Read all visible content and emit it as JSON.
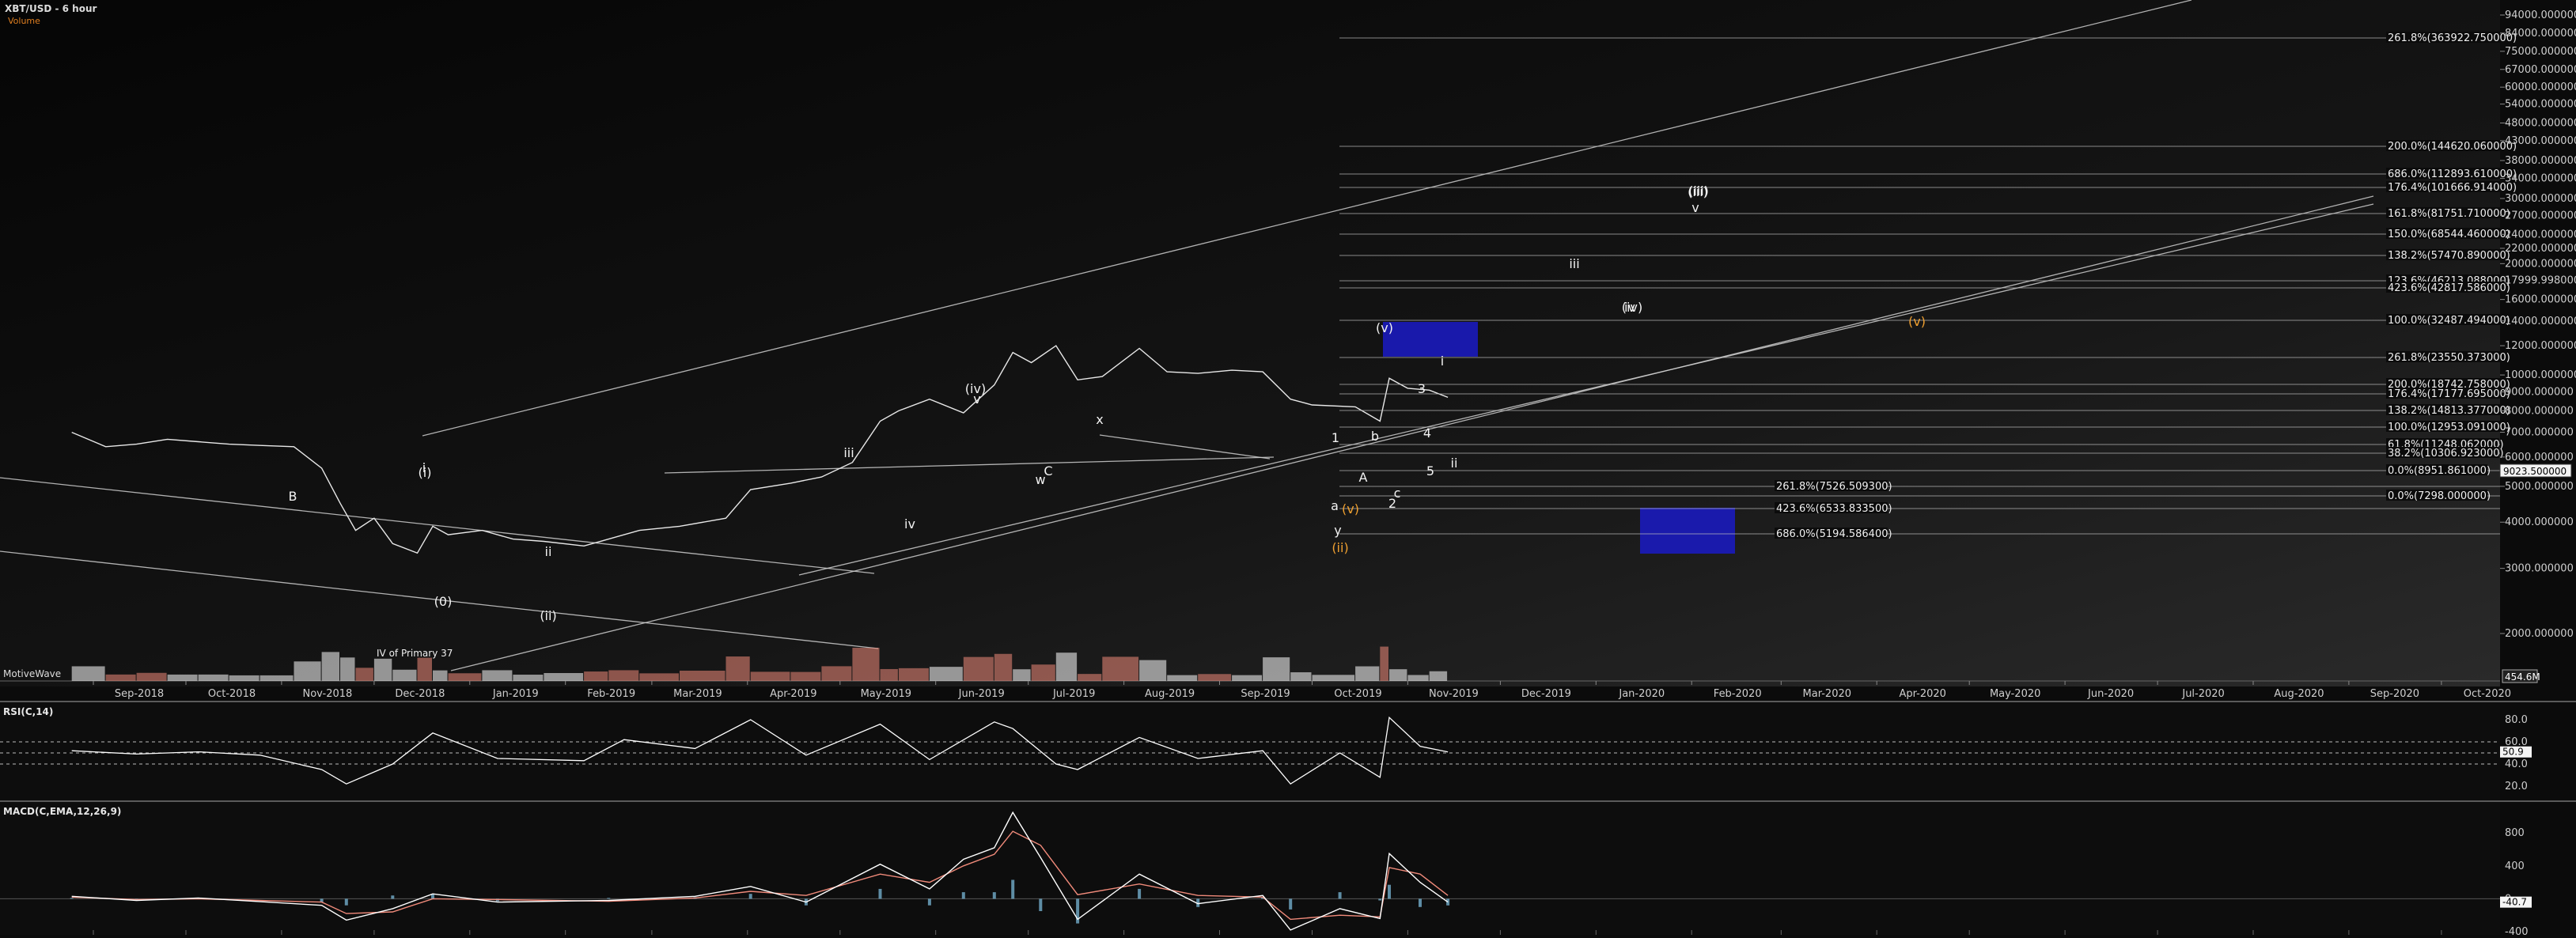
{
  "header": {
    "title": "XBT/USD - 6 hour",
    "subtitle": "Volume",
    "watermark": "MotiveWave",
    "volume_readout": "454.6M",
    "price_readout": "9023.500000",
    "annotation_primary": "IV of Primary 37"
  },
  "colors": {
    "background": "#0b0b0b",
    "price": "#e8e8e8",
    "volume_up": "#f08a7a",
    "volume_down": "#ffffff",
    "rsi": "#ffffff",
    "rsi_fill": "#c8a6b0",
    "macd": "#ffffff",
    "signal": "#f08a7a",
    "histogram": "#7ab8d8",
    "target_box": "#1a1ab8",
    "wave_orange": "#f0a030",
    "wave_red": "#ff3030"
  },
  "chart_data": [
    {
      "type": "line",
      "title": "XBT/USD - 6 hour",
      "y_scale": "log",
      "ylim": [
        1500,
        100000
      ],
      "x_ticks": [
        "Sep-2018",
        "Oct-2018",
        "Nov-2018",
        "Dec-2018",
        "Jan-2019",
        "Feb-2019",
        "Mar-2019",
        "Apr-2019",
        "May-2019",
        "Jun-2019",
        "Jul-2019",
        "Aug-2019",
        "Sep-2019",
        "Oct-2019",
        "Nov-2019",
        "Dec-2019",
        "Jan-2020",
        "Feb-2020",
        "Mar-2020",
        "Apr-2020",
        "May-2020",
        "Jun-2020",
        "Jul-2020",
        "Aug-2020",
        "Sep-2020",
        "Oct-2020"
      ],
      "y_ticks": [
        2000,
        3000,
        4000,
        5000,
        6000,
        7000,
        8000,
        9000,
        10000,
        12000,
        14000,
        16000,
        18000,
        20000,
        22000,
        24000,
        27000,
        30000,
        34000,
        38000,
        43000,
        48000,
        54000,
        60000,
        67000,
        75000,
        84000,
        94000
      ],
      "y_tick_labels": [
        "2000.000000",
        "3000.000000",
        "4000.000000",
        "5000.000000",
        "6000.000000",
        "7000.000000",
        "8000.000000",
        "9000.000000",
        "10000.000000",
        "12000.000000",
        "14000.000000",
        "16000.000000",
        "17999.998000",
        "20000.000000",
        "22000.000000",
        "24000.000000",
        "27000.000000",
        "30000.000000",
        "34000.000000",
        "38000.000000",
        "43000.000000",
        "48000.000000",
        "54000.000000",
        "60000.000000",
        "67000.000000",
        "75000.000000",
        "84000.000000",
        "94000.000000"
      ],
      "series": [
        {
          "x": [
            "2018-08-25",
            "2018-09-05",
            "2018-09-15",
            "2018-09-25",
            "2018-10-05",
            "2018-10-15",
            "2018-10-25",
            "2018-11-05",
            "2018-11-14",
            "2018-11-20",
            "2018-11-25",
            "2018-12-01",
            "2018-12-07",
            "2018-12-15",
            "2018-12-20",
            "2018-12-25",
            "2019-01-05",
            "2019-01-15",
            "2019-01-25",
            "2019-02-07",
            "2019-02-15",
            "2019-02-25",
            "2019-03-10",
            "2019-03-25",
            "2019-04-02",
            "2019-04-15",
            "2019-04-25",
            "2019-05-05",
            "2019-05-14",
            "2019-05-20",
            "2019-05-30",
            "2019-06-10",
            "2019-06-20",
            "2019-06-26",
            "2019-07-02",
            "2019-07-10",
            "2019-07-17",
            "2019-07-25",
            "2019-08-06",
            "2019-08-15",
            "2019-08-25",
            "2019-09-05",
            "2019-09-15",
            "2019-09-24",
            "2019-10-01",
            "2019-10-15",
            "2019-10-23",
            "2019-10-26",
            "2019-11-01",
            "2019-11-08",
            "2019-11-14"
          ],
          "y": [
            7000,
            6400,
            6500,
            6700,
            6600,
            6500,
            6450,
            6400,
            5600,
            4500,
            3800,
            4100,
            3500,
            3300,
            3900,
            3700,
            3800,
            3600,
            3550,
            3450,
            3600,
            3800,
            3900,
            4100,
            4900,
            5100,
            5300,
            5800,
            7500,
            8000,
            8600,
            7900,
            9400,
            11500,
            10800,
            12000,
            9700,
            9900,
            11800,
            10200,
            10100,
            10300,
            10200,
            8600,
            8300,
            8200,
            7500,
            9800,
            9200,
            9100,
            8700
          ]
        }
      ],
      "fib_labels": [
        "261.8%(363922.750000)",
        "200.0%(144620.060000)",
        "686.0%(112893.610000)",
        "176.4%(101666.914000)",
        "161.8%(81751.710000)",
        "150.0%(68544.460000)",
        "138.2%(57470.890000)",
        "123.6%(46213.088000)",
        "423.6%(42817.586000)",
        "100.0%(32487.494000)",
        "261.8%(23550.373000)",
        "200.0%(18742.758000)",
        "176.4%(17177.695000)",
        "138.2%(14813.377000)",
        "100.0%(12953.091000)",
        "61.8%(11248.062000)",
        "38.2%(10306.923000)",
        "0.0%(8951.861000)",
        "0.0%(7298.000000)",
        "261.8%(7526.509300)",
        "423.6%(6533.833500)",
        "686.0%(5194.586400)"
      ],
      "wave_labels": [
        "B",
        "i",
        "ii",
        "(i)",
        "(ii)",
        "(0)",
        "iii",
        "(iv)",
        "(v)",
        "iv",
        "v",
        "(iii)",
        "w",
        "x",
        "y",
        "(ii)",
        "(v)",
        "(iii)",
        "v",
        "(iv)",
        "iii",
        "iv",
        "(v)",
        "i",
        "ii",
        "1",
        "2",
        "3",
        "4",
        "5",
        "A",
        "C",
        "a",
        "b",
        "c"
      ]
    },
    {
      "type": "line",
      "title": "RSI(C,14)",
      "ylim": [
        10,
        90
      ],
      "y_ticks": [
        20,
        40,
        50,
        60,
        80
      ],
      "y_tick_labels": [
        "20.0",
        "40.0",
        "50.0",
        "60.0",
        "80.0"
      ],
      "readout": "50.9",
      "series": [
        {
          "x": [
            "2018-08-25",
            "2018-09-15",
            "2018-10-05",
            "2018-10-25",
            "2018-11-14",
            "2018-11-22",
            "2018-12-07",
            "2018-12-20",
            "2019-01-10",
            "2019-02-07",
            "2019-02-20",
            "2019-03-15",
            "2019-04-02",
            "2019-04-20",
            "2019-05-14",
            "2019-05-30",
            "2019-06-20",
            "2019-06-26",
            "2019-07-10",
            "2019-07-17",
            "2019-08-06",
            "2019-08-25",
            "2019-09-15",
            "2019-09-24",
            "2019-10-10",
            "2019-10-23",
            "2019-10-26",
            "2019-11-05",
            "2019-11-14"
          ],
          "y": [
            52,
            49,
            51,
            48,
            35,
            22,
            40,
            68,
            45,
            43,
            62,
            54,
            80,
            48,
            76,
            44,
            78,
            72,
            40,
            35,
            64,
            45,
            52,
            22,
            50,
            28,
            82,
            56,
            50.9
          ]
        }
      ]
    },
    {
      "type": "line",
      "title": "MACD(C,EMA,12,26,9)",
      "ylim": [
        -400,
        1100
      ],
      "y_ticks": [
        -400,
        0,
        400,
        800
      ],
      "y_tick_labels": [
        "-400",
        "0",
        "400",
        "800"
      ],
      "readout": "-40.7",
      "series": [
        {
          "name": "MACD",
          "x": [
            "2018-08-25",
            "2018-09-15",
            "2018-10-05",
            "2018-11-14",
            "2018-11-22",
            "2018-12-07",
            "2018-12-20",
            "2019-01-10",
            "2019-02-15",
            "2019-03-15",
            "2019-04-02",
            "2019-04-20",
            "2019-05-14",
            "2019-05-30",
            "2019-06-10",
            "2019-06-20",
            "2019-06-26",
            "2019-07-05",
            "2019-07-17",
            "2019-08-06",
            "2019-08-25",
            "2019-09-15",
            "2019-09-24",
            "2019-10-10",
            "2019-10-23",
            "2019-10-26",
            "2019-11-05",
            "2019-11-14"
          ],
          "y": [
            30,
            -20,
            10,
            -80,
            -260,
            -120,
            60,
            -40,
            -20,
            30,
            150,
            -40,
            420,
            120,
            480,
            620,
            1050,
            500,
            -250,
            300,
            -60,
            40,
            -380,
            -120,
            -240,
            550,
            200,
            -40.7
          ]
        },
        {
          "name": "Signal",
          "x": [
            "2018-08-25",
            "2018-09-15",
            "2018-10-05",
            "2018-11-14",
            "2018-11-22",
            "2018-12-07",
            "2018-12-20",
            "2019-01-10",
            "2019-02-15",
            "2019-03-15",
            "2019-04-02",
            "2019-04-20",
            "2019-05-14",
            "2019-05-30",
            "2019-06-10",
            "2019-06-20",
            "2019-06-26",
            "2019-07-05",
            "2019-07-17",
            "2019-08-06",
            "2019-08-25",
            "2019-09-15",
            "2019-09-24",
            "2019-10-10",
            "2019-10-23",
            "2019-10-26",
            "2019-11-05",
            "2019-11-14"
          ],
          "y": [
            20,
            -10,
            0,
            -40,
            -180,
            -160,
            0,
            -10,
            -30,
            10,
            90,
            40,
            300,
            200,
            400,
            540,
            820,
            650,
            50,
            180,
            40,
            20,
            -250,
            -200,
            -220,
            380,
            300,
            40
          ]
        }
      ]
    }
  ]
}
